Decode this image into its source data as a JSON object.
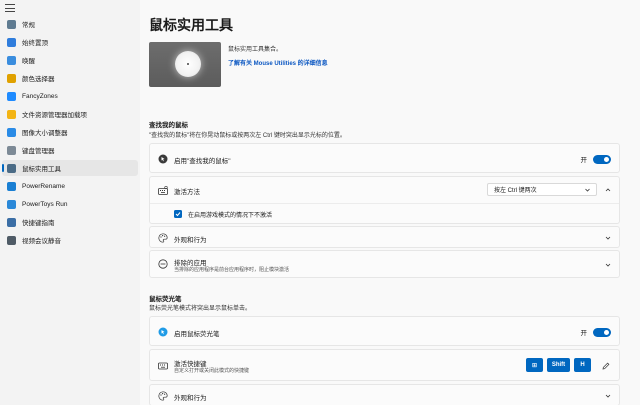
{
  "sidebar": {
    "items": [
      {
        "label": "常规",
        "icon": "home-icon",
        "color": "#5f7b91"
      },
      {
        "label": "始终置顶",
        "icon": "pin-icon",
        "color": "#2f7ddc"
      },
      {
        "label": "唤醒",
        "icon": "coffee-icon",
        "color": "#3a8dde"
      },
      {
        "label": "颜色选择器",
        "icon": "color-picker-icon",
        "color": "#e0a100"
      },
      {
        "label": "FancyZones",
        "icon": "fancyzones-icon",
        "color": "#1f8bff"
      },
      {
        "label": "文件资源管理器加载项",
        "icon": "file-explorer-icon",
        "color": "#f3b414"
      },
      {
        "label": "图像大小调整器",
        "icon": "image-resizer-icon",
        "color": "#2a8be6"
      },
      {
        "label": "键盘管理器",
        "icon": "keyboard-icon",
        "color": "#7d8a96"
      },
      {
        "label": "鼠标实用工具",
        "icon": "mouse-icon",
        "color": "#4b6b86"
      },
      {
        "label": "PowerRename",
        "icon": "powerrename-icon",
        "color": "#1a7fd3"
      },
      {
        "label": "PowerToys Run",
        "icon": "powertoys-run-icon",
        "color": "#2a88d8"
      },
      {
        "label": "快捷键指南",
        "icon": "shortcut-guide-icon",
        "color": "#3b6ea5"
      },
      {
        "label": "视频会议静音",
        "icon": "video-mute-icon",
        "color": "#4f5b66"
      }
    ],
    "active_index": 8
  },
  "page": {
    "title": "鼠标实用工具",
    "description": "鼠标实用工具集合。",
    "learn_more": "了解有关 Mouse Utilities 的详细信息"
  },
  "find_mouse": {
    "section_title": "查找我的鼠标",
    "section_desc": "\"查找我的鼠标\"将在你晃动鼠标或按两次左 Ctrl 键时突出显示光标的位置。",
    "enable_label": "启用\"查找我的鼠标\"",
    "enable_state": "开",
    "activation_label": "激活方法",
    "activation_value": "按左 Ctrl 键两次",
    "checkbox_label": "在启用游戏模式的情况下不激活",
    "appearance_label": "外观和行为",
    "excluded_label": "排除的应用",
    "excluded_desc": "当排除的应用程序是前台应用程序时，阻止模块激活"
  },
  "highlighter": {
    "section_title": "鼠标荧光笔",
    "section_desc": "鼠标荧光笔模式将突出显示鼠标单击。",
    "enable_label": "启用鼠标荧光笔",
    "enable_state": "开",
    "shortcut_label": "激活快捷键",
    "shortcut_desc": "自定义打开或关闭此模式的快捷键",
    "keys": [
      "⊞",
      "Shift",
      "H"
    ],
    "appearance_label": "外观和行为"
  },
  "colors": {
    "accent": "#0067c0",
    "link": "#0b57c2"
  }
}
